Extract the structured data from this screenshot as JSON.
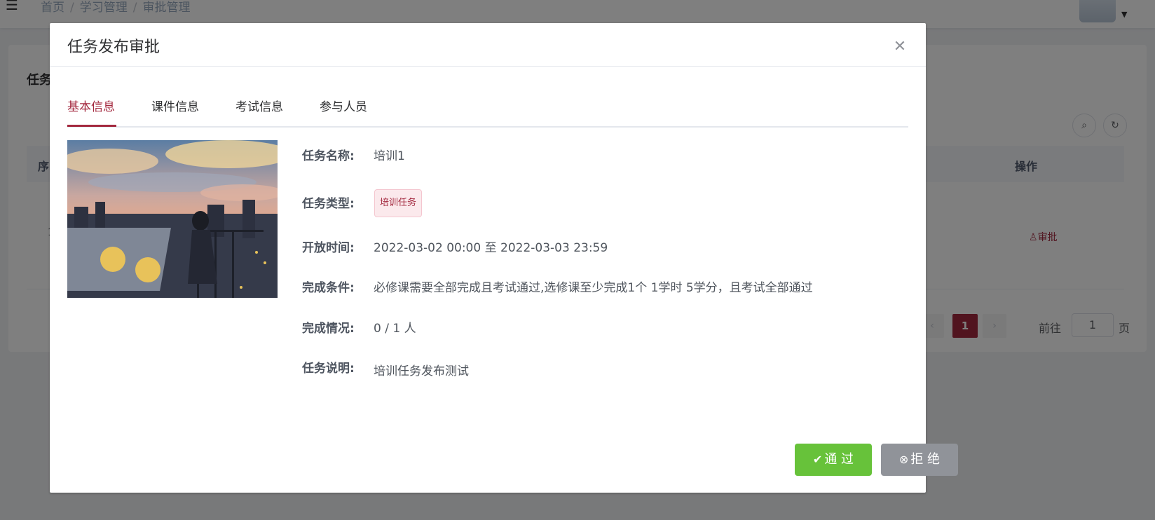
{
  "breadcrumb": {
    "items": [
      "首页",
      "学习管理",
      "审批管理"
    ]
  },
  "background": {
    "card_title": "任务",
    "table_head_left": "序",
    "table_head_action": "操作",
    "row_index": "1",
    "row_action": "审批",
    "pager_current": "1",
    "pager_goto": "前往",
    "pager_input": "1",
    "pager_page": "页"
  },
  "dialog": {
    "title": "任务发布审批",
    "tabs": [
      "基本信息",
      "课件信息",
      "考试信息",
      "参与人员"
    ],
    "fields": {
      "name_label": "任务名称:",
      "name_value": "培训1",
      "type_label": "任务类型:",
      "type_value": "培训任务",
      "time_label": "开放时间:",
      "time_value": "2022-03-02 00:00 至 2022-03-03 23:59",
      "cond_label": "完成条件:",
      "cond_value": "必修课需要全部完成且考试通过,选修课至少完成1个 1学时 5学分，且考试全部通过",
      "status_label": "完成情况:",
      "status_value": "0 / 1 人",
      "desc_label": "任务说明:",
      "desc_value": "培训任务发布测试"
    },
    "buttons": {
      "pass": "通 过",
      "reject": "拒 绝"
    }
  },
  "colors": {
    "accent": "#a3283e",
    "pass": "#67c23a",
    "reject": "#909399"
  }
}
